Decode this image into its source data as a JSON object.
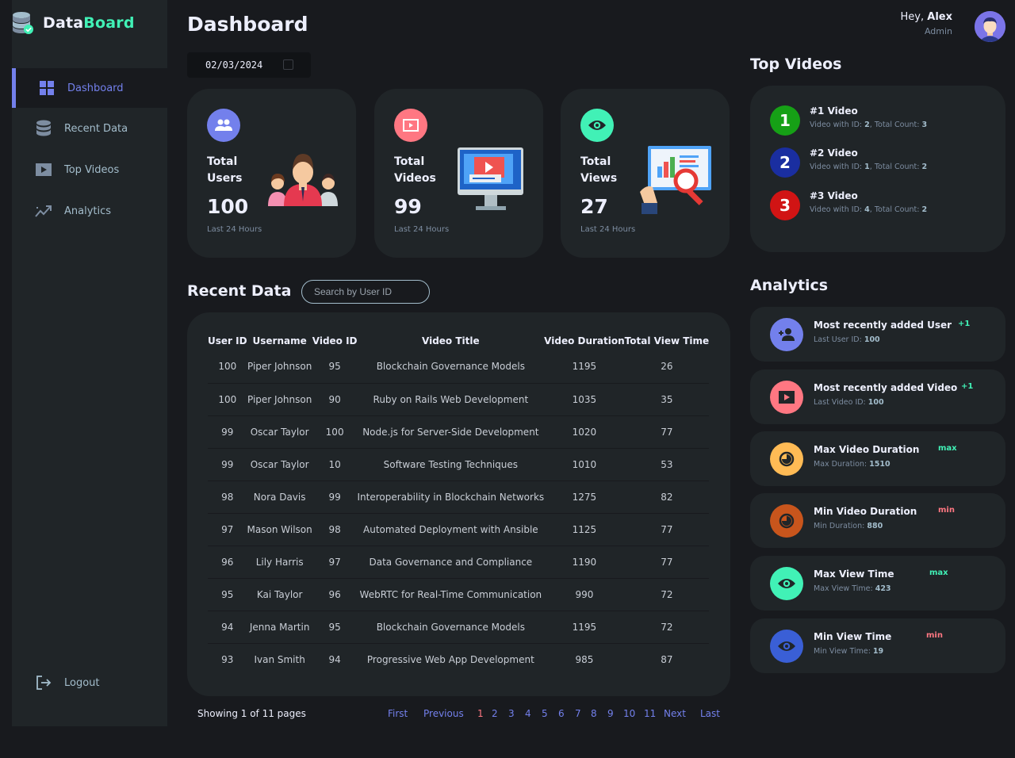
{
  "app": {
    "brand_part1": "Data",
    "brand_part2": "Board",
    "brand_colors": {
      "primary": "#7380ec",
      "accent": "#41f1b6",
      "danger": "#ff7782",
      "warning": "#ffbb55"
    }
  },
  "sidebar": {
    "items": [
      {
        "label": "Dashboard",
        "icon": "grid-icon",
        "active": true
      },
      {
        "label": "Recent Data",
        "icon": "database-icon",
        "active": false
      },
      {
        "label": "Top Videos",
        "icon": "play-icon",
        "active": false
      },
      {
        "label": "Analytics",
        "icon": "trend-icon",
        "active": false
      }
    ],
    "logout_label": "Logout"
  },
  "header": {
    "title": "Dashboard",
    "date": "02/03/2024",
    "greeting": "Hey,",
    "user_name": "Alex",
    "user_role": "Admin"
  },
  "stats": [
    {
      "label": "Total Users",
      "value": "100",
      "sub": "Last 24 Hours",
      "icon": "users-icon",
      "color": "#7380ec"
    },
    {
      "label": "Total Videos",
      "value": "99",
      "sub": "Last 24 Hours",
      "icon": "video-icon",
      "color": "#ff7782"
    },
    {
      "label": "Total Views",
      "value": "27",
      "sub": "Last 24 Hours",
      "icon": "eye-icon",
      "color": "#41f1b6"
    }
  ],
  "recent": {
    "title": "Recent Data",
    "search_placeholder": "Search by User ID",
    "columns": [
      "User ID",
      "Username",
      "Video ID",
      "Video Title",
      "Video Duration",
      "Total View Time"
    ],
    "rows": [
      [
        "100",
        "Piper Johnson",
        "95",
        "Blockchain Governance Models",
        "1195",
        "26"
      ],
      [
        "100",
        "Piper Johnson",
        "90",
        "Ruby on Rails Web Development",
        "1035",
        "35"
      ],
      [
        "99",
        "Oscar Taylor",
        "100",
        "Node.js for Server-Side Development",
        "1020",
        "77"
      ],
      [
        "99",
        "Oscar Taylor",
        "10",
        "Software Testing Techniques",
        "1010",
        "53"
      ],
      [
        "98",
        "Nora Davis",
        "99",
        "Interoperability in Blockchain Networks",
        "1275",
        "82"
      ],
      [
        "97",
        "Mason Wilson",
        "98",
        "Automated Deployment with Ansible",
        "1125",
        "77"
      ],
      [
        "96",
        "Lily Harris",
        "97",
        "Data Governance and Compliance",
        "1190",
        "77"
      ],
      [
        "95",
        "Kai Taylor",
        "96",
        "WebRTC for Real-Time Communication",
        "990",
        "72"
      ],
      [
        "94",
        "Jenna Martin",
        "95",
        "Blockchain Governance Models",
        "1195",
        "72"
      ],
      [
        "93",
        "Ivan Smith",
        "94",
        "Progressive Web App Development",
        "985",
        "87"
      ]
    ],
    "pagination": {
      "info": "Showing 1 of 11 pages",
      "first": "First",
      "previous": "Previous",
      "pages": [
        "1",
        "2",
        "3",
        "4",
        "5",
        "6",
        "7",
        "8",
        "9",
        "10",
        "11"
      ],
      "next": "Next",
      "last": "Last"
    }
  },
  "top_videos": {
    "title": "Top Videos",
    "items": [
      {
        "rank": "1",
        "title": "#1 Video",
        "sub_prefix": "Video with ID: ",
        "id": "2",
        "count_prefix": ", Total Count: ",
        "count": "3",
        "color": "#16a016"
      },
      {
        "rank": "2",
        "title": "#2 Video",
        "sub_prefix": "Video with ID: ",
        "id": "1",
        "count_prefix": ", Total Count: ",
        "count": "2",
        "color": "#1a2ea0"
      },
      {
        "rank": "3",
        "title": "#3 Video",
        "sub_prefix": "Video with ID: ",
        "id": "4",
        "count_prefix": ", Total Count: ",
        "count": "2",
        "color": "#d11414"
      }
    ]
  },
  "analytics": {
    "title": "Analytics",
    "items": [
      {
        "title": "Most recently added User",
        "sub_label": "Last User ID: ",
        "sub_value": "100",
        "badge": "+1",
        "badge_color": "#41f1b6",
        "icon": "user-plus-icon",
        "icon_bg": "#7380ec"
      },
      {
        "title": "Most recently added Video",
        "sub_label": "Last Video ID: ",
        "sub_value": "100",
        "badge": "+1",
        "badge_color": "#41f1b6",
        "icon": "video-icon",
        "icon_bg": "#ff7782"
      },
      {
        "title": "Max Video Duration",
        "sub_label": "Max Duration: ",
        "sub_value": "1510",
        "badge": "max",
        "badge_color": "#41f1b6",
        "icon": "timer-icon",
        "icon_bg": "#ffbb55"
      },
      {
        "title": "Min Video Duration",
        "sub_label": "Min Duration: ",
        "sub_value": "880",
        "badge": "min",
        "badge_color": "#ff7782",
        "icon": "timer-icon",
        "icon_bg": "#c8551c"
      },
      {
        "title": "Max View Time",
        "sub_label": "Max View Time: ",
        "sub_value": "423",
        "badge": "max",
        "badge_color": "#41f1b6",
        "icon": "eye-icon",
        "icon_bg": "#41f1b6"
      },
      {
        "title": "Min View Time",
        "sub_label": "Min View Time: ",
        "sub_value": "19",
        "badge": "min",
        "badge_color": "#ff7782",
        "icon": "eye-icon",
        "icon_bg": "#3a5fd6"
      }
    ]
  }
}
